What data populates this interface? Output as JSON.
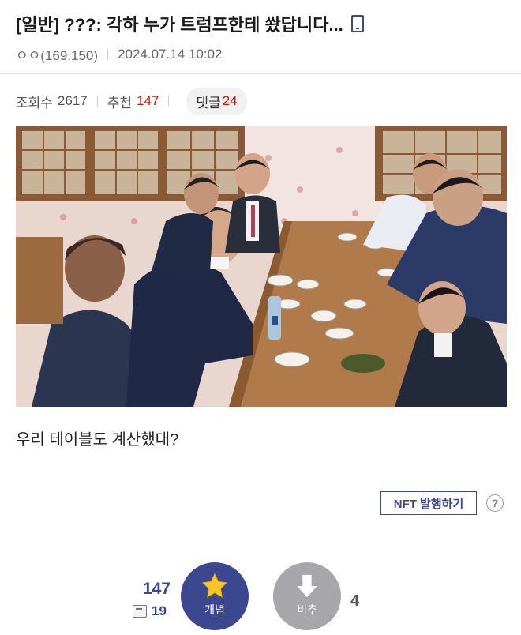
{
  "post": {
    "title": "[일반] ???: 각하 누가 트럼프한테 쐈답니다...",
    "author": "ㅇㅇ(169.150)",
    "datetime": "2024.07.14 10:02",
    "mobile_icon": "mobile-phone-icon"
  },
  "stats": {
    "views_label": "조회수",
    "views": "2617",
    "recommend_label": "추천",
    "recommend": "147",
    "comments_label": "댓글",
    "comments": "24"
  },
  "content": {
    "photo_description": "group dinner photo",
    "text": "우리 테이블도 계산했대?"
  },
  "actions": {
    "nft_label": "NFT 발행하기",
    "help_glyph": "?",
    "recommend_total": "147",
    "fixed_count": "19",
    "up_label": "개념",
    "down_label": "비추",
    "down_count": "4"
  },
  "colors": {
    "accent": "#3b4890",
    "red": "#d31900",
    "gray_button": "#a7a7ab"
  }
}
